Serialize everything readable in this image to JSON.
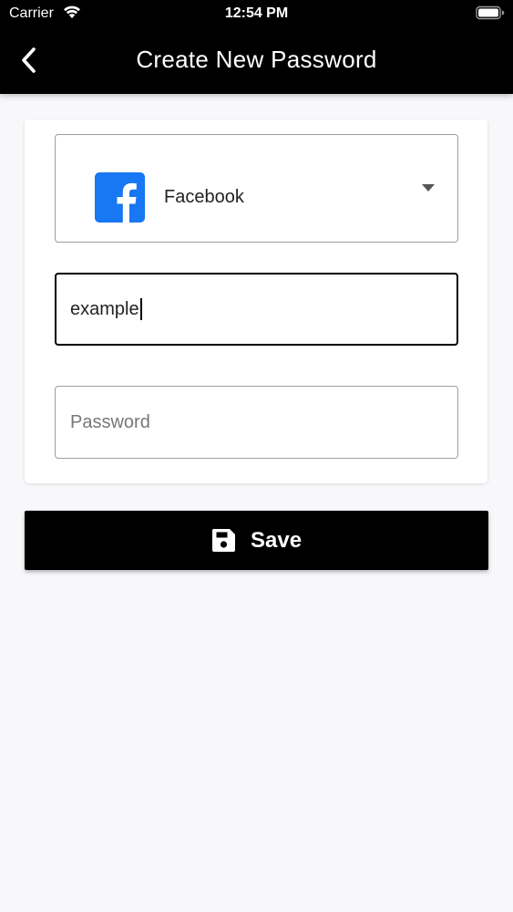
{
  "status_bar": {
    "carrier": "Carrier",
    "time": "12:54 PM",
    "wifi_icon": "wifi-icon",
    "battery_icon": "battery-icon"
  },
  "header": {
    "title": "Create New Password",
    "back_icon": "chevron-left-icon"
  },
  "form": {
    "platform_select": {
      "selected": "Facebook",
      "icon": "facebook-icon",
      "caret_icon": "caret-down-icon"
    },
    "username": {
      "value": "example"
    },
    "password": {
      "value": "",
      "placeholder": "Password"
    }
  },
  "save_button": {
    "label": "Save",
    "icon": "floppy-disk-icon"
  },
  "colors": {
    "header_bg": "#000000",
    "page_bg": "#f8f7fa",
    "facebook_blue": "#1877f2",
    "button_bg": "#000000"
  }
}
